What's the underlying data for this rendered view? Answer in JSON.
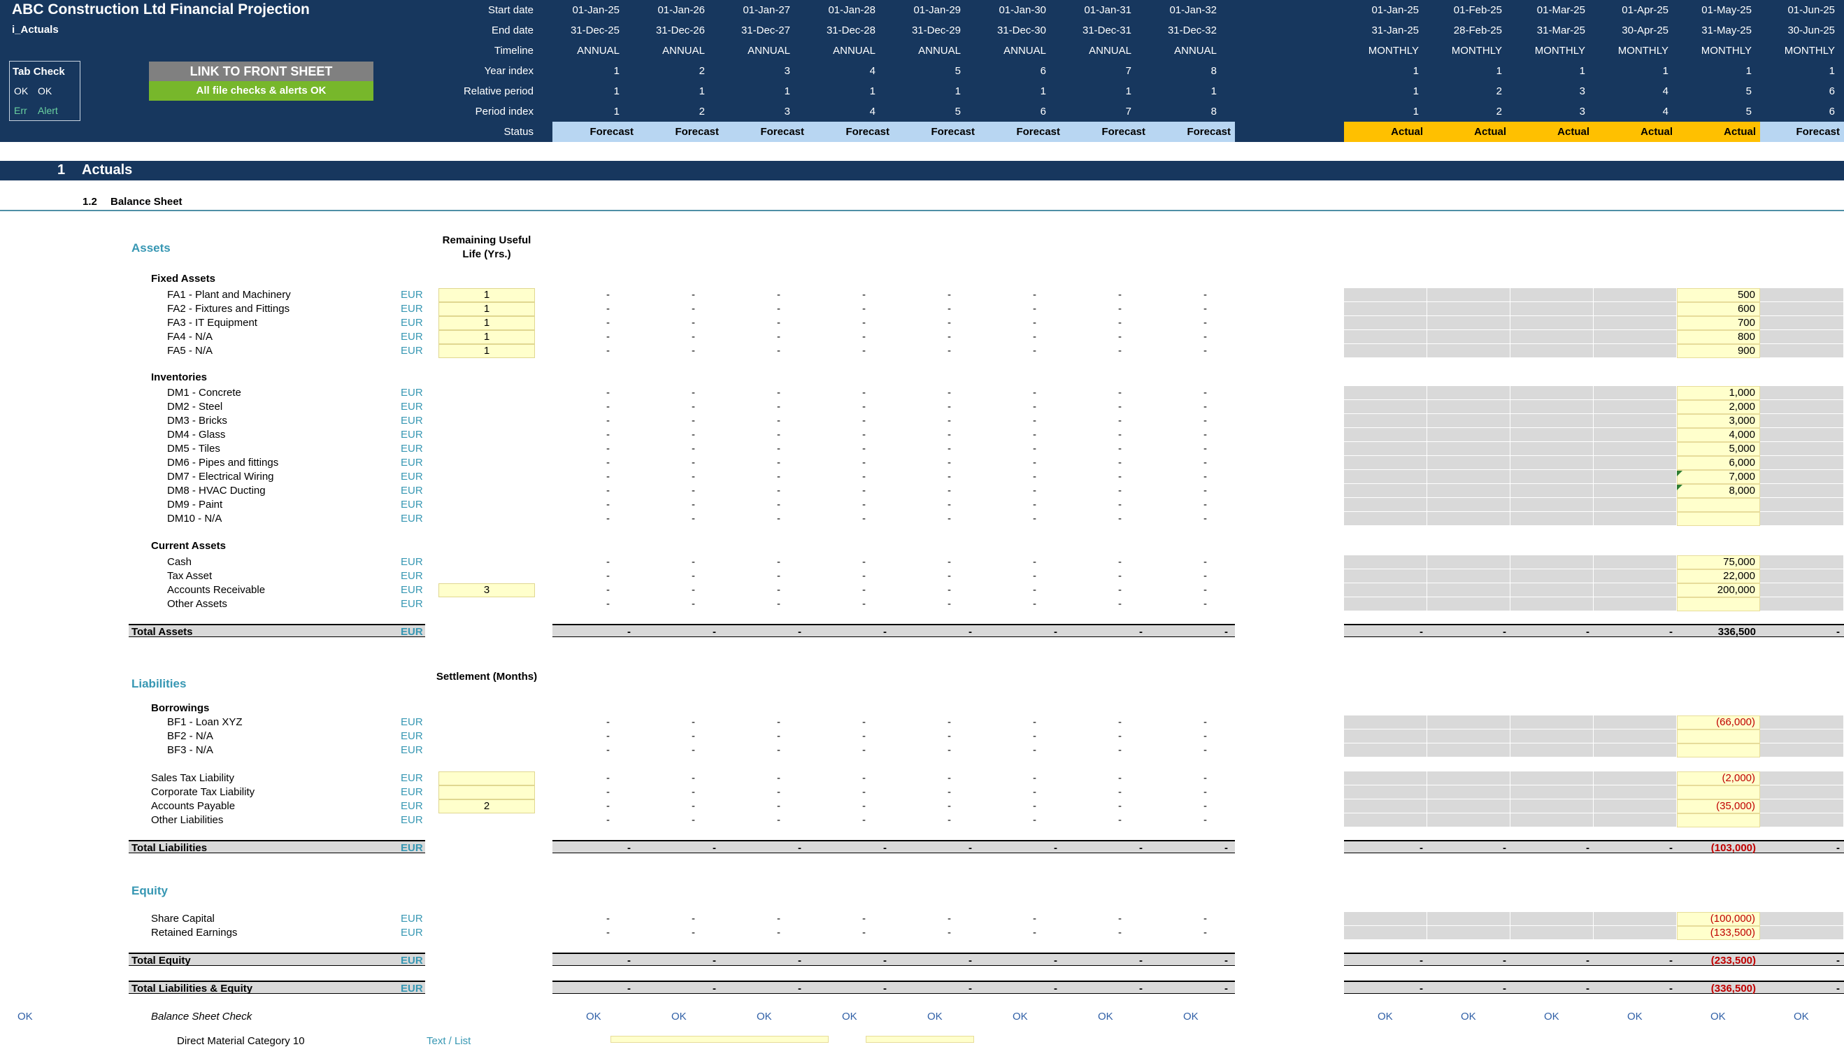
{
  "header": {
    "title": "ABC Construction Ltd Financial Projection",
    "sheet": "i_Actuals",
    "tab_check": {
      "title": "Tab Check",
      "ok_code": "OK",
      "ok_text": "OK",
      "err_code": "Err",
      "err_text": "Alert"
    },
    "link_button": "LINK TO FRONT SHEET",
    "checks_status": "All file checks & alerts OK",
    "row_labels": [
      "Start date",
      "End date",
      "Timeline",
      "Year index",
      "Relative period",
      "Period index",
      "Status"
    ],
    "annual": {
      "start": [
        "01-Jan-25",
        "01-Jan-26",
        "01-Jan-27",
        "01-Jan-28",
        "01-Jan-29",
        "01-Jan-30",
        "01-Jan-31",
        "01-Jan-32"
      ],
      "end": [
        "31-Dec-25",
        "31-Dec-26",
        "31-Dec-27",
        "31-Dec-28",
        "31-Dec-29",
        "31-Dec-30",
        "31-Dec-31",
        "31-Dec-32"
      ],
      "timeline": [
        "ANNUAL",
        "ANNUAL",
        "ANNUAL",
        "ANNUAL",
        "ANNUAL",
        "ANNUAL",
        "ANNUAL",
        "ANNUAL"
      ],
      "year_index": [
        "1",
        "2",
        "3",
        "4",
        "5",
        "6",
        "7",
        "8"
      ],
      "relative": [
        "1",
        "1",
        "1",
        "1",
        "1",
        "1",
        "1",
        "1"
      ],
      "period_index": [
        "1",
        "2",
        "3",
        "4",
        "5",
        "6",
        "7",
        "8"
      ],
      "status": [
        "Forecast",
        "Forecast",
        "Forecast",
        "Forecast",
        "Forecast",
        "Forecast",
        "Forecast",
        "Forecast"
      ]
    },
    "monthly": {
      "start": [
        "01-Jan-25",
        "01-Feb-25",
        "01-Mar-25",
        "01-Apr-25",
        "01-May-25",
        "01-Jun-25"
      ],
      "end": [
        "31-Jan-25",
        "28-Feb-25",
        "31-Mar-25",
        "30-Apr-25",
        "31-May-25",
        "30-Jun-25"
      ],
      "timeline": [
        "MONTHLY",
        "MONTHLY",
        "MONTHLY",
        "MONTHLY",
        "MONTHLY",
        "MONTHLY"
      ],
      "year_index": [
        "1",
        "1",
        "1",
        "1",
        "1",
        "1"
      ],
      "relative": [
        "1",
        "2",
        "3",
        "4",
        "5",
        "6"
      ],
      "period_index": [
        "1",
        "2",
        "3",
        "4",
        "5",
        "6"
      ],
      "status": [
        "Actual",
        "Actual",
        "Actual",
        "Actual",
        "Actual",
        "Forecast"
      ]
    }
  },
  "section": {
    "number": "1",
    "title": "Actuals"
  },
  "subsection": {
    "number": "1.2",
    "title": "Balance Sheet"
  },
  "dash": "-",
  "assets": {
    "title": "Assets",
    "col_header": "Remaining Useful Life (Yrs.)",
    "groups": [
      {
        "name": "Fixed Assets",
        "rows": [
          {
            "label": "FA1 - Plant and Machinery",
            "unit": "EUR",
            "input": "1",
            "may": "500"
          },
          {
            "label": "FA2 - Fixtures and Fittings",
            "unit": "EUR",
            "input": "1",
            "may": "600"
          },
          {
            "label": "FA3 - IT Equipment",
            "unit": "EUR",
            "input": "1",
            "may": "700"
          },
          {
            "label": "FA4 - N/A",
            "unit": "EUR",
            "input": "1",
            "may": "800"
          },
          {
            "label": "FA5 - N/A",
            "unit": "EUR",
            "input": "1",
            "may": "900"
          }
        ]
      },
      {
        "name": "Inventories",
        "rows": [
          {
            "label": "DM1 - Concrete",
            "unit": "EUR",
            "may": "1,000"
          },
          {
            "label": "DM2 - Steel",
            "unit": "EUR",
            "may": "2,000"
          },
          {
            "label": "DM3 - Bricks",
            "unit": "EUR",
            "may": "3,000"
          },
          {
            "label": "DM4 - Glass",
            "unit": "EUR",
            "may": "4,000"
          },
          {
            "label": "DM5 - Tiles",
            "unit": "EUR",
            "may": "5,000"
          },
          {
            "label": "DM6 - Pipes and fittings",
            "unit": "EUR",
            "may": "6,000"
          },
          {
            "label": "DM7 - Electrical Wiring",
            "unit": "EUR",
            "may": "7,000"
          },
          {
            "label": "DM8 - HVAC Ducting",
            "unit": "EUR",
            "may": "8,000"
          },
          {
            "label": "DM9 - Paint",
            "unit": "EUR",
            "may": ""
          },
          {
            "label": "DM10 - N/A",
            "unit": "EUR",
            "may": ""
          }
        ]
      },
      {
        "name": "Current Assets",
        "rows": [
          {
            "label": "Cash",
            "unit": "EUR",
            "may": "75,000"
          },
          {
            "label": "Tax Asset",
            "unit": "EUR",
            "may": "22,000"
          },
          {
            "label": "Accounts Receivable",
            "unit": "EUR",
            "input": "3",
            "may": "200,000"
          },
          {
            "label": "Other Assets",
            "unit": "EUR",
            "may": ""
          }
        ]
      }
    ],
    "total": {
      "label": "Total Assets",
      "unit": "EUR",
      "may": "336,500"
    }
  },
  "liabilities": {
    "title": "Liabilities",
    "col_header": "Settlement (Months)",
    "borrowings": {
      "name": "Borrowings",
      "rows": [
        {
          "label": "BF1 - Loan XYZ",
          "unit": "EUR",
          "may": "(66,000)"
        },
        {
          "label": "BF2 - N/A",
          "unit": "EUR",
          "may": ""
        },
        {
          "label": "BF3 - N/A",
          "unit": "EUR",
          "may": ""
        }
      ]
    },
    "other": [
      {
        "label": "Sales Tax Liability",
        "unit": "EUR",
        "input": "",
        "may": "(2,000)"
      },
      {
        "label": "Corporate Tax Liability",
        "unit": "EUR",
        "input": "",
        "may": ""
      },
      {
        "label": "Accounts Payable",
        "unit": "EUR",
        "input": "2",
        "may": "(35,000)"
      },
      {
        "label": "Other Liabilities",
        "unit": "EUR",
        "may": ""
      }
    ],
    "total": {
      "label": "Total Liabilities",
      "unit": "EUR",
      "may": "(103,000)"
    }
  },
  "equity": {
    "title": "Equity",
    "rows": [
      {
        "label": "Share Capital",
        "unit": "EUR",
        "may": "(100,000)"
      },
      {
        "label": "Retained Earnings",
        "unit": "EUR",
        "may": "(133,500)"
      }
    ],
    "total": {
      "label": "Total Equity",
      "unit": "EUR",
      "may": "(233,500)"
    },
    "total_le": {
      "label": "Total Liabilities & Equity",
      "unit": "EUR",
      "may": "(336,500)"
    }
  },
  "check": {
    "left_ok": "OK",
    "label": "Balance Sheet Check",
    "value": "OK"
  },
  "footer": {
    "label": "Direct Material Category 10",
    "type": "Text / List"
  },
  "colors": {
    "navy": "#17375e",
    "forecast": "#b8d6f2",
    "actual": "#ffc000",
    "accent": "#3797b3",
    "input": "#ffffcc",
    "negative": "#c00000"
  }
}
